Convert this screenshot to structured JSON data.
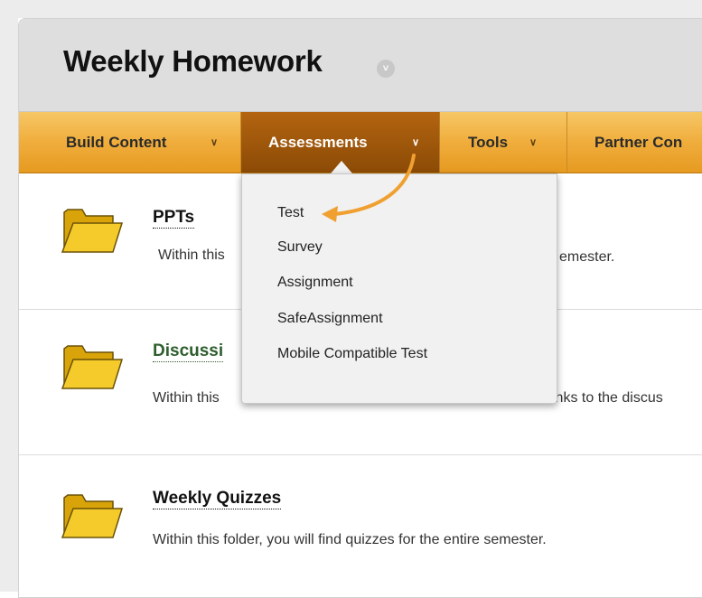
{
  "header": {
    "title": "Weekly Homework"
  },
  "toolbar": {
    "build_content": "Build Content",
    "assessments": "Assessments",
    "tools": "Tools",
    "partner_content": "Partner Con"
  },
  "assessments_menu": {
    "items": [
      {
        "label": "Test"
      },
      {
        "label": "Survey"
      },
      {
        "label": "Assignment"
      },
      {
        "label": "SafeAssignment"
      },
      {
        "label": "Mobile Compatible Test"
      }
    ]
  },
  "content": {
    "items": [
      {
        "title": "PPTs",
        "desc_left": "Within this",
        "desc_right": "emester."
      },
      {
        "title": "Discussi",
        "desc_left": "Within this",
        "desc_right": "inks to the discus"
      },
      {
        "title": "Weekly Quizzes",
        "desc_left": "Within this folder, you will find quizzes for the entire semester."
      }
    ]
  },
  "colors": {
    "toolbar": "#f0ad3c",
    "active_tab": "#a0580a",
    "highlight_arrow": "#f0a030",
    "folder": "#f2c318"
  },
  "icons": {
    "folder": "folder-icon",
    "chevron": "chevron-down-icon",
    "annotation_arrow": "curved-arrow-annotation"
  }
}
